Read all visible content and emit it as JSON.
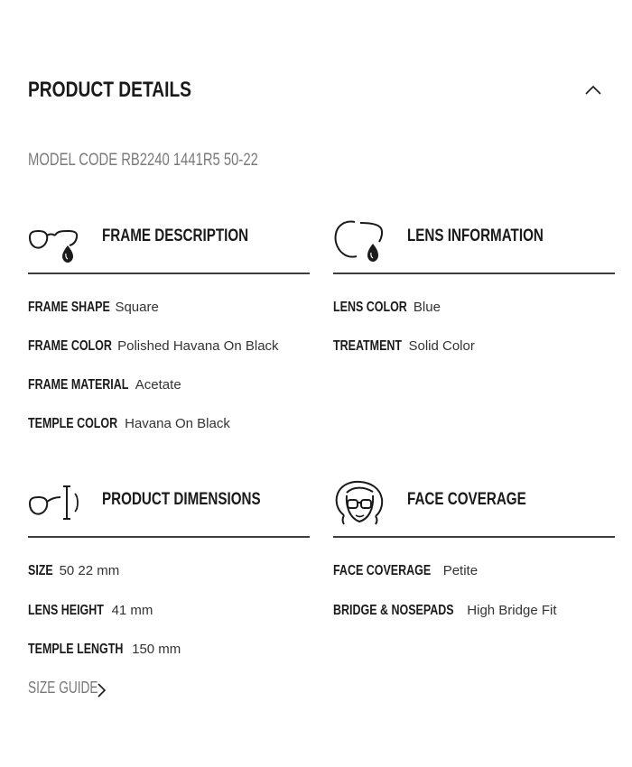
{
  "header": {
    "title": "PRODUCT DETAILS",
    "toggle_icon": "chevron-up-icon"
  },
  "model_code": "MODEL CODE RB2240 1441R5 50-22",
  "sections": {
    "frame": {
      "title": "FRAME DESCRIPTION",
      "icon": "sunglasses-drop-icon",
      "rows": [
        {
          "label": "FRAME SHAPE",
          "value": "Square"
        },
        {
          "label": "FRAME COLOR",
          "value": "Polished Havana On Black"
        },
        {
          "label": "FRAME MATERIAL",
          "value": "Acetate"
        },
        {
          "label": "TEMPLE COLOR",
          "value": "Havana On Black"
        }
      ]
    },
    "lens": {
      "title": "LENS INFORMATION",
      "icon": "lens-drop-icon",
      "rows": [
        {
          "label": "LENS COLOR",
          "value": "Blue"
        },
        {
          "label": "TREATMENT",
          "value": "Solid Color"
        }
      ]
    },
    "dimensions": {
      "title": "PRODUCT DIMENSIONS",
      "icon": "glasses-ruler-icon",
      "rows": [
        {
          "label": "SIZE",
          "value": "50 22 mm"
        },
        {
          "label": "LENS HEIGHT",
          "value": "41 mm"
        },
        {
          "label": "TEMPLE LENGTH",
          "value": "150 mm"
        }
      ]
    },
    "face": {
      "title": "FACE COVERAGE",
      "icon": "face-glasses-icon",
      "rows": [
        {
          "label": "FACE COVERAGE",
          "value": "Petite"
        },
        {
          "label": "BRIDGE & NOSEPADS",
          "value": "High Bridge Fit"
        }
      ]
    }
  },
  "size_guide": {
    "label": "SIZE GUIDE",
    "icon": "chevron-right-icon"
  }
}
